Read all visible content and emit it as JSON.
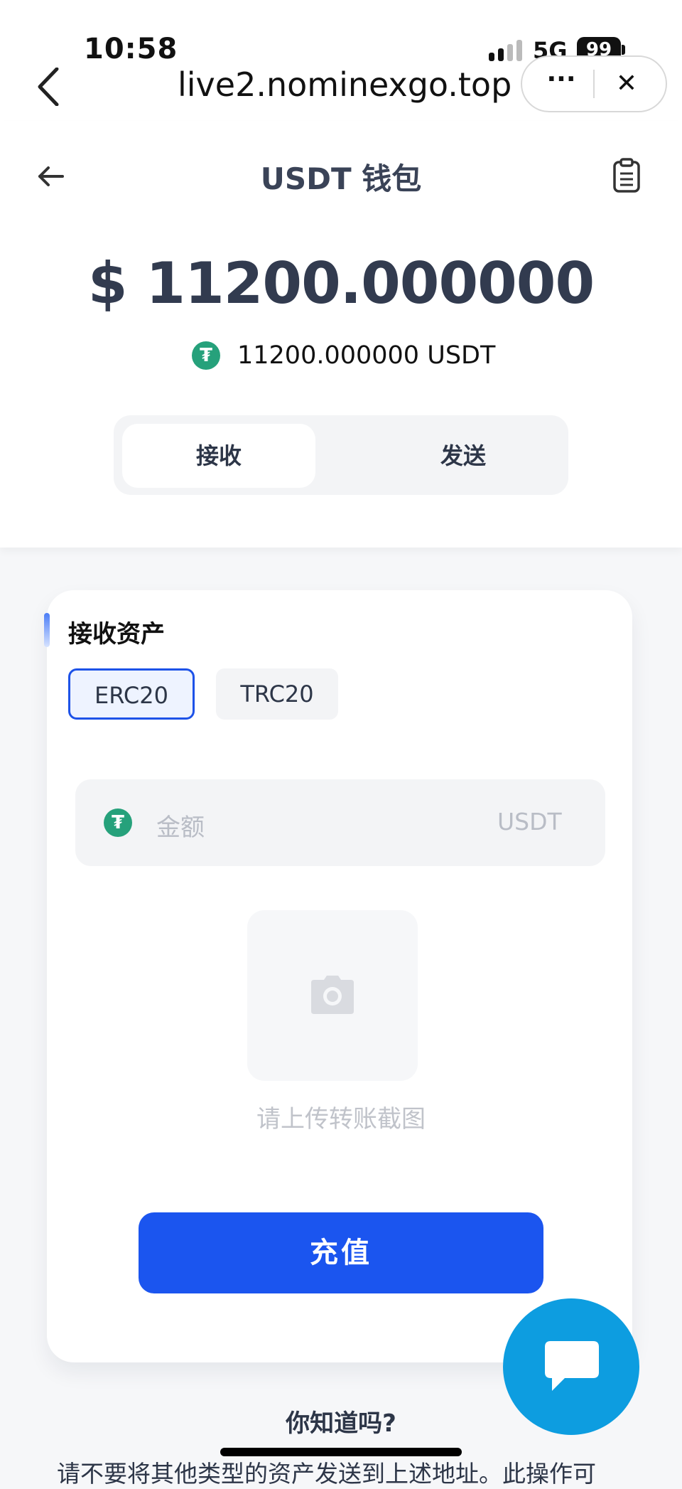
{
  "status_bar": {
    "time": "10:58",
    "network": "5G",
    "battery": "99"
  },
  "browser": {
    "url": "live2.nominexgo.top",
    "more_label": "···",
    "close_label": "✕"
  },
  "header": {
    "title": "USDT 钱包"
  },
  "balance": {
    "main": "$ 11200.000000",
    "sub": "11200.000000 USDT",
    "coin_symbol": "₮"
  },
  "tabs": [
    {
      "label": "接收",
      "active": true
    },
    {
      "label": "发送",
      "active": false
    }
  ],
  "card": {
    "title": "接收资产",
    "networks": [
      {
        "label": "ERC20",
        "selected": true
      },
      {
        "label": "TRC20",
        "selected": false
      }
    ],
    "amount_placeholder": "金额",
    "amount_unit": "USDT",
    "upload_label": "请上传转账截图",
    "submit_label": "充值"
  },
  "info": {
    "title": "你知道吗?",
    "text": "请不要将其他类型的资产发送到上述地址。此操作可"
  },
  "colors": {
    "primary": "#1b55ef",
    "chat": "#0d9de0",
    "usdt": "#26a17b"
  }
}
